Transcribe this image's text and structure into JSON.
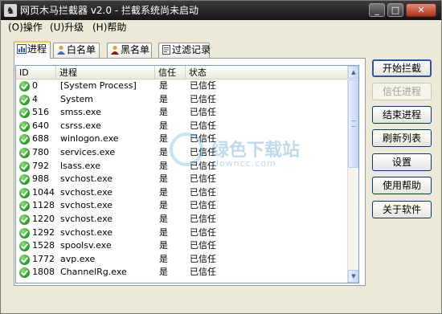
{
  "window": {
    "title": "网页木马拦截器 v2.0 - 拦截系统尚未启动",
    "icon": "horse-icon"
  },
  "menu": [
    {
      "label": "(O)操作"
    },
    {
      "label": "(U)升级"
    },
    {
      "label": "(H)帮助"
    }
  ],
  "tabs": [
    {
      "label": "进程",
      "icon": "process-icon",
      "active": true
    },
    {
      "label": "白名单",
      "icon": "whitelist-icon",
      "active": false
    },
    {
      "label": "黑名单",
      "icon": "blacklist-icon",
      "active": false
    },
    {
      "label": "过滤记录",
      "icon": "log-icon",
      "active": false
    }
  ],
  "table": {
    "columns": [
      "ID",
      "进程",
      "信任",
      "状态"
    ],
    "rows": [
      {
        "id": "0",
        "name": "[System Process]",
        "trust": "是",
        "status": "已信任"
      },
      {
        "id": "4",
        "name": "System",
        "trust": "是",
        "status": "已信任"
      },
      {
        "id": "516",
        "name": "smss.exe",
        "trust": "是",
        "status": "已信任"
      },
      {
        "id": "640",
        "name": "csrss.exe",
        "trust": "是",
        "status": "已信任"
      },
      {
        "id": "688",
        "name": "winlogon.exe",
        "trust": "是",
        "status": "已信任"
      },
      {
        "id": "780",
        "name": "services.exe",
        "trust": "是",
        "status": "已信任"
      },
      {
        "id": "792",
        "name": "lsass.exe",
        "trust": "是",
        "status": "已信任"
      },
      {
        "id": "988",
        "name": "svchost.exe",
        "trust": "是",
        "status": "已信任"
      },
      {
        "id": "1044",
        "name": "svchost.exe",
        "trust": "是",
        "status": "已信任"
      },
      {
        "id": "1128",
        "name": "svchost.exe",
        "trust": "是",
        "status": "已信任"
      },
      {
        "id": "1220",
        "name": "svchost.exe",
        "trust": "是",
        "status": "已信任"
      },
      {
        "id": "1292",
        "name": "svchost.exe",
        "trust": "是",
        "status": "已信任"
      },
      {
        "id": "1528",
        "name": "spoolsv.exe",
        "trust": "是",
        "status": "已信任"
      },
      {
        "id": "1772",
        "name": "avp.exe",
        "trust": "是",
        "status": "已信任"
      },
      {
        "id": "1808",
        "name": "ChannelRg.exe",
        "trust": "是",
        "status": "已信任"
      }
    ],
    "row_icon": "green-check-icon"
  },
  "buttons": [
    {
      "label": "开始拦截",
      "enabled": true,
      "default": true
    },
    {
      "label": "信任进程",
      "enabled": false,
      "default": false
    },
    {
      "label": "结束进程",
      "enabled": true,
      "default": false
    },
    {
      "label": "刷新列表",
      "enabled": true,
      "default": false
    },
    {
      "label": "设置",
      "enabled": true,
      "default": false
    },
    {
      "label": "使用帮助",
      "enabled": true,
      "default": false
    },
    {
      "label": "关于软件",
      "enabled": true,
      "default": false
    }
  ],
  "watermark": {
    "text": "绿色下载站",
    "url": "downcc.com"
  },
  "colors": {
    "titlebar": "#1e1e1e",
    "dialog_bg": "#ece9d8",
    "check_green": "#1f9a1f",
    "active_tab_accent": "#ffc83c",
    "default_button_border": "#2a54bd"
  }
}
